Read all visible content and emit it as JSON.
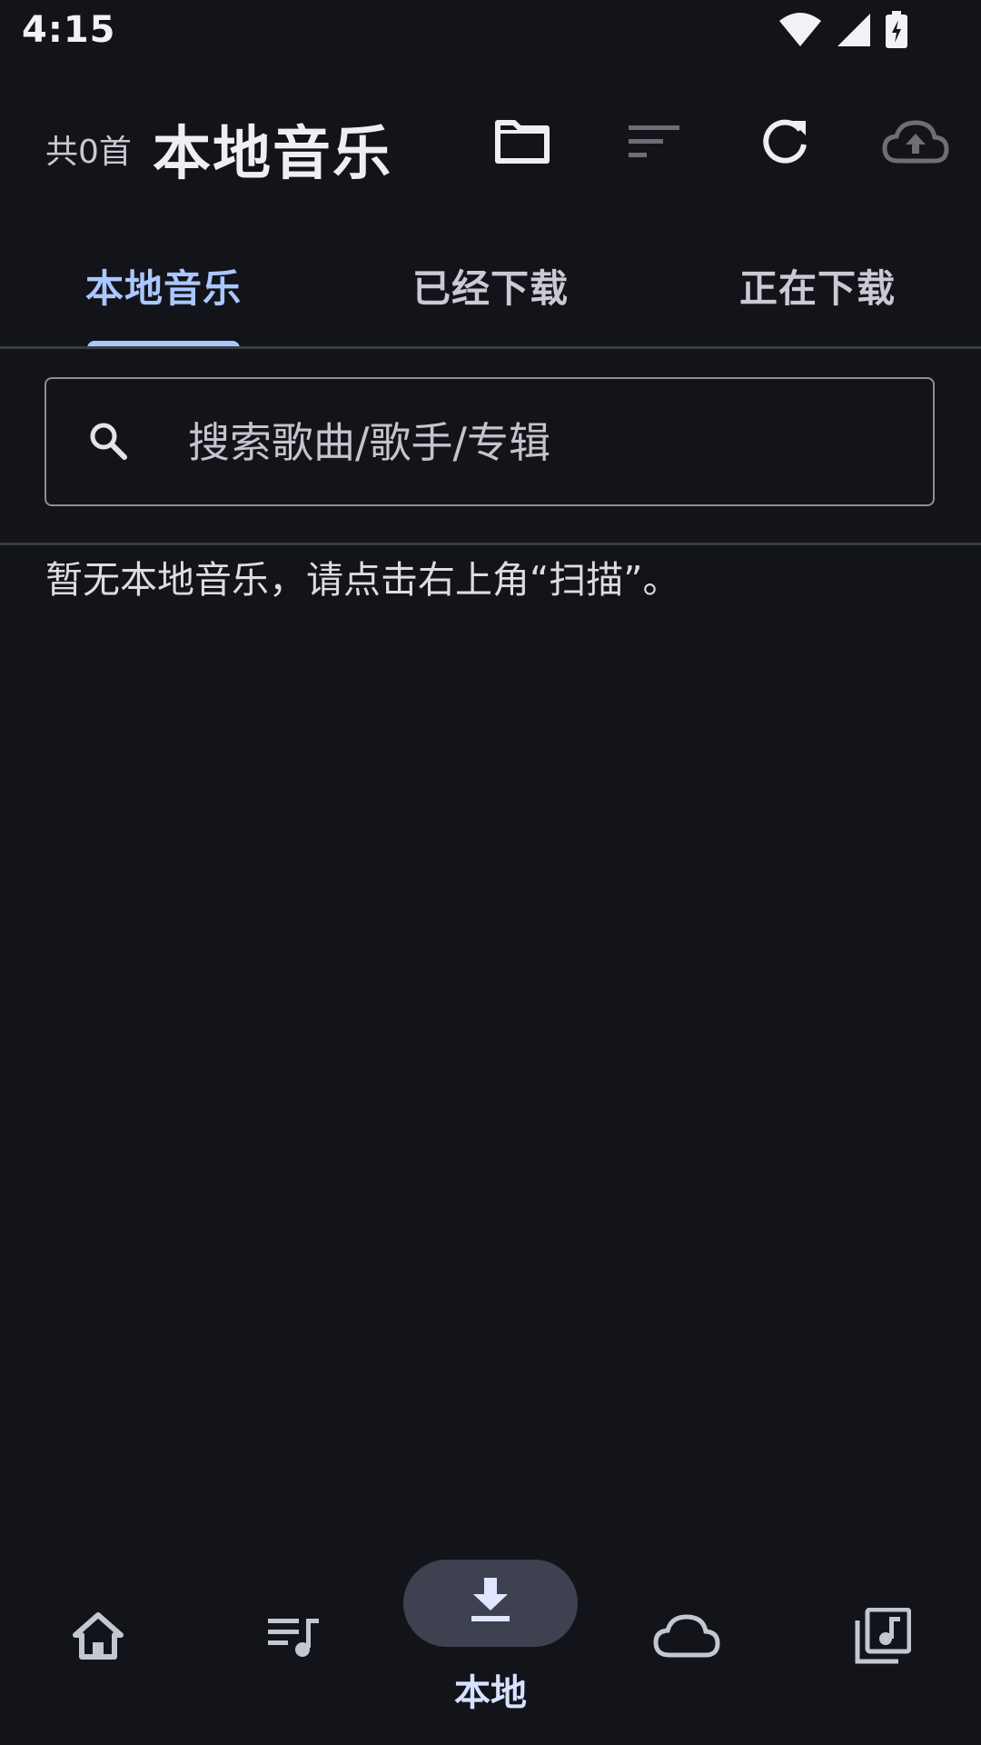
{
  "status_bar": {
    "time": "4:15",
    "icons": [
      "wifi-icon",
      "signal-icon",
      "battery-charging-icon"
    ]
  },
  "header": {
    "song_count": "共0首",
    "title": "本地音乐",
    "actions": [
      "folder-icon",
      "sort-icon",
      "refresh-icon",
      "cloud-upload-icon"
    ]
  },
  "tabs": {
    "items": [
      {
        "label": "本地音乐",
        "active": true
      },
      {
        "label": "已经下载",
        "active": false
      },
      {
        "label": "正在下载",
        "active": false
      }
    ]
  },
  "search": {
    "placeholder": "搜索歌曲/歌手/专辑",
    "value": ""
  },
  "main": {
    "empty_message": "暂无本地音乐，请点击右上角“扫描”。"
  },
  "bottom_nav": {
    "items": [
      {
        "icon": "home-icon",
        "label": ""
      },
      {
        "icon": "queue-music-icon",
        "label": ""
      },
      {
        "icon": "download-icon",
        "label": "本地",
        "active": true
      },
      {
        "icon": "cloud-icon",
        "label": ""
      },
      {
        "icon": "library-music-icon",
        "label": ""
      }
    ]
  },
  "colors": {
    "background": "#13141a",
    "accent": "#aac7ff",
    "active_pill": "#3d4150",
    "divider": "#3a3c44"
  }
}
